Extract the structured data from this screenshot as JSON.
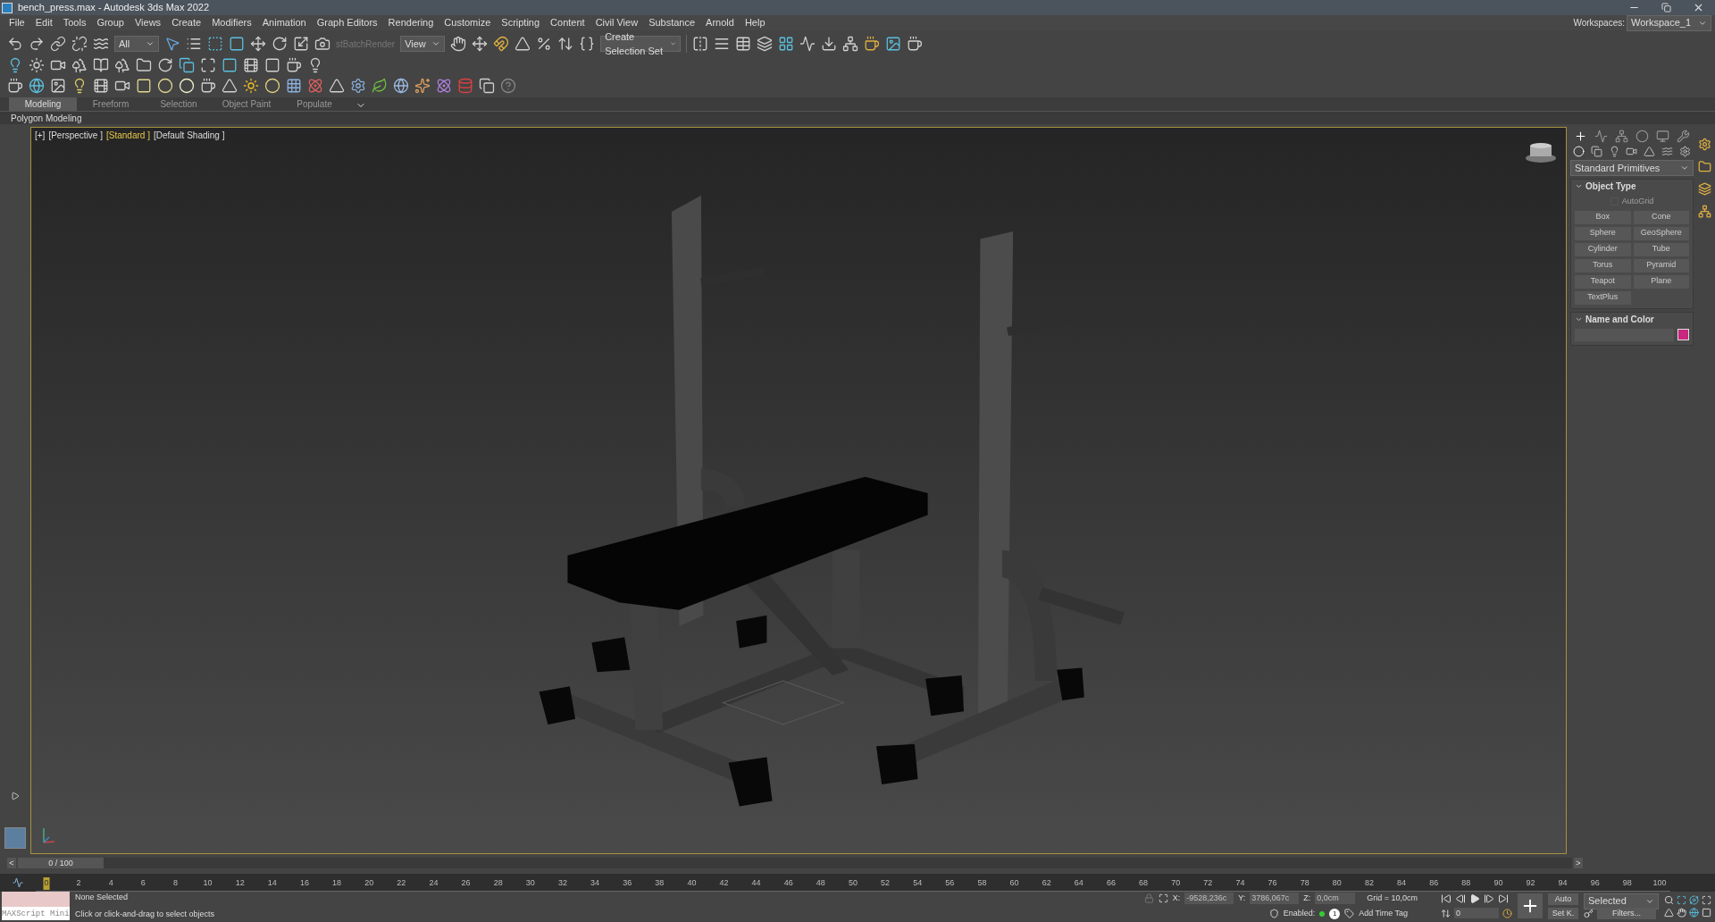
{
  "window": {
    "title": "bench_press.max - Autodesk 3ds Max 2022"
  },
  "menu": [
    "File",
    "Edit",
    "Tools",
    "Group",
    "Views",
    "Create",
    "Modifiers",
    "Animation",
    "Graph Editors",
    "Rendering",
    "Customize",
    "Scripting",
    "Content",
    "Civil View",
    "Substance",
    "Arnold",
    "Help"
  ],
  "workspaces": {
    "label": "Workspaces:",
    "value": "Workspace_1"
  },
  "toolbar": {
    "selection_filter": "All",
    "batch_render": "stBatchRender",
    "reference_coord": "View",
    "selection_set": "Create Selection Set"
  },
  "ribbon_tabs": [
    {
      "label": "Modeling",
      "selected": true
    },
    {
      "label": "Freeform",
      "selected": false
    },
    {
      "label": "Selection",
      "selected": false
    },
    {
      "label": "Object Paint",
      "selected": false
    },
    {
      "label": "Populate",
      "selected": false
    }
  ],
  "ribbon_panel": "Polygon Modeling",
  "viewport": {
    "labels": [
      {
        "text": "[+]",
        "highlighted": false
      },
      {
        "text": "[Perspective ]",
        "highlighted": false
      },
      {
        "text": "[Standard ]",
        "highlighted": true
      },
      {
        "text": "[Default Shading ]",
        "highlighted": false
      }
    ]
  },
  "command_panel": {
    "category": "Standard Primitives",
    "object_type": {
      "title": "Object Type",
      "autogrid": {
        "label": "AutoGrid",
        "checked": false,
        "disabled": true
      },
      "buttons": [
        "Box",
        "Cone",
        "Sphere",
        "GeoSphere",
        "Cylinder",
        "Tube",
        "Torus",
        "Pyramid",
        "Teapot",
        "Plane",
        "TextPlus"
      ]
    },
    "name_and_color": {
      "title": "Name and Color",
      "color": "#c8267f"
    }
  },
  "time_slider": {
    "value": "0 / 100",
    "level": 0,
    "prev": "<",
    "next": ">"
  },
  "track_ticks": [
    "0",
    "2",
    "4",
    "6",
    "8",
    "10",
    "12",
    "14",
    "16",
    "18",
    "20",
    "22",
    "24",
    "26",
    "28",
    "30",
    "32",
    "34",
    "36",
    "38",
    "40",
    "42",
    "44",
    "46",
    "48",
    "50",
    "52",
    "54",
    "56",
    "58",
    "60",
    "62",
    "64",
    "66",
    "68",
    "70",
    "72",
    "74",
    "76",
    "78",
    "80",
    "82",
    "84",
    "86",
    "88",
    "90",
    "92",
    "94",
    "96",
    "98",
    "100"
  ],
  "status": {
    "maxscript_placeholder": "MAXScript Mini",
    "selection": "None Selected",
    "prompt": "Click or click-and-drag to select objects",
    "x_label": "X:",
    "x": "-9528,236c",
    "y_label": "Y:",
    "y": "3786,067c",
    "z_label": "Z:",
    "z": "0,0cm",
    "grid": "Grid = 10,0cm",
    "enabled": "Enabled:",
    "enabled_count": "1",
    "time_tag": "Add Time Tag",
    "frame": "0",
    "auto": "Auto",
    "set_key": "Set K.",
    "key_filter": "Selected",
    "filters": "Filters..."
  }
}
